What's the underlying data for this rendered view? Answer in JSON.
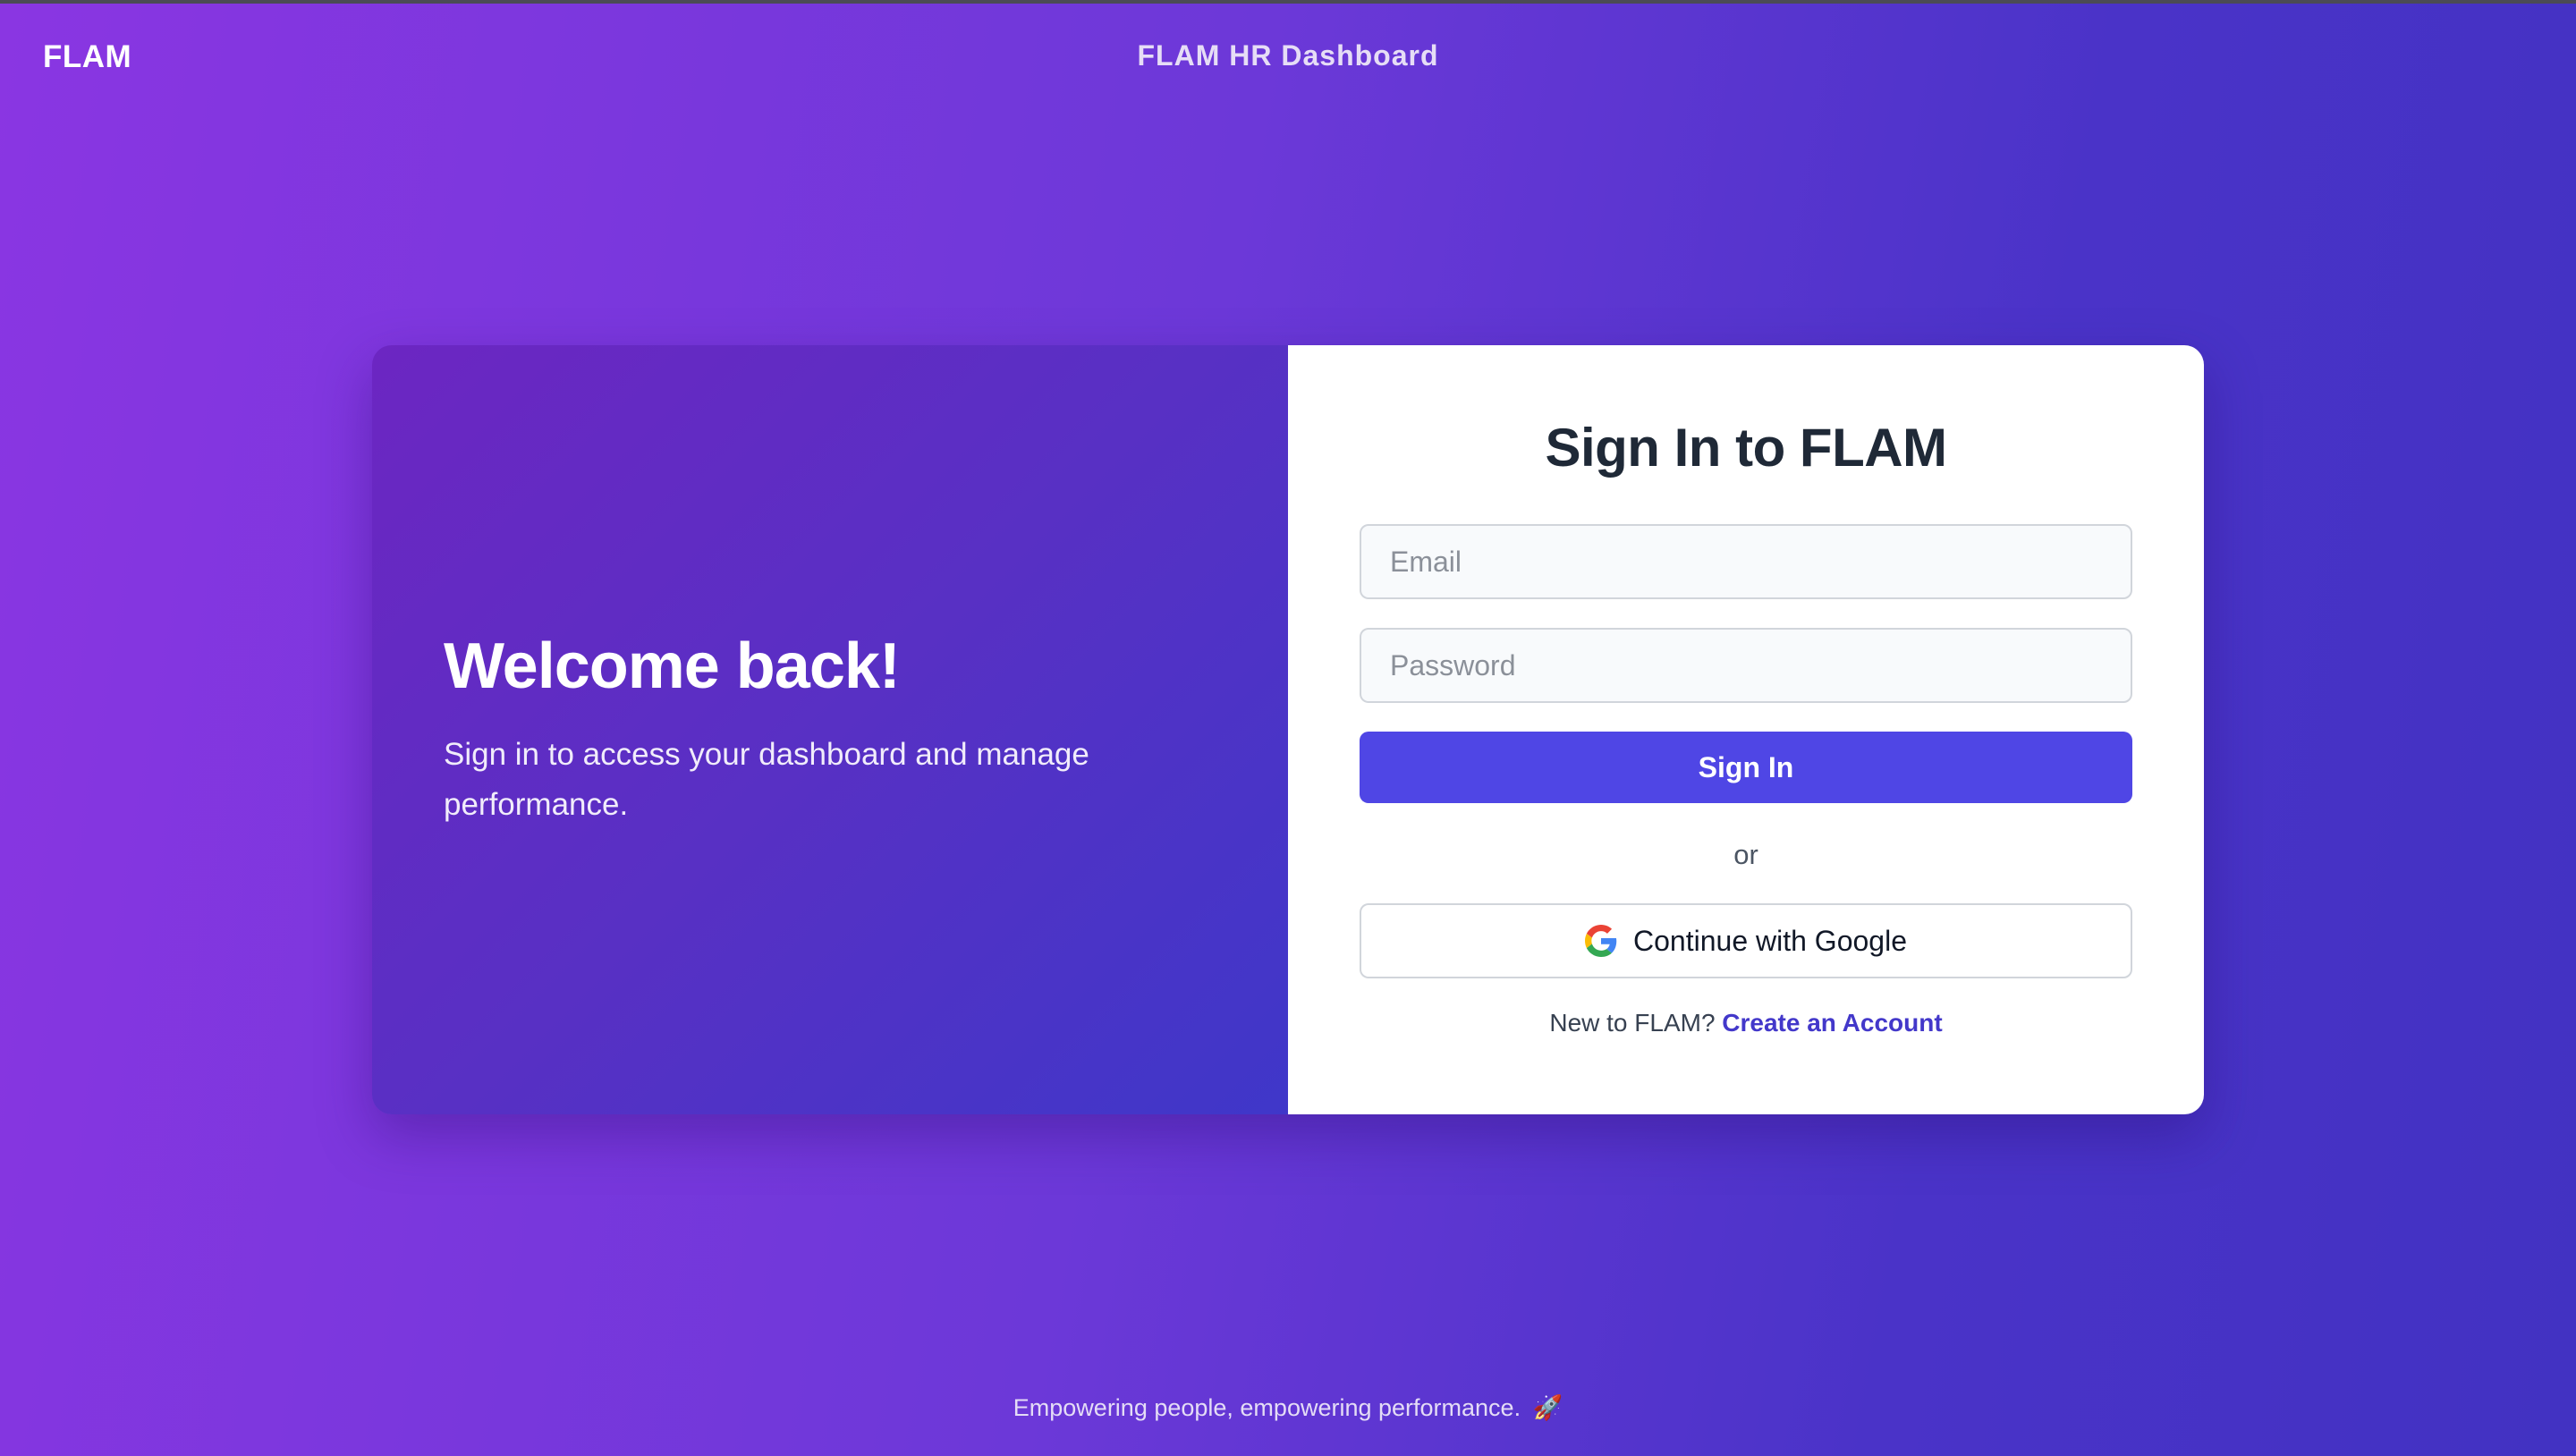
{
  "header": {
    "logo": "FLAM",
    "title": "FLAM HR Dashboard"
  },
  "welcome": {
    "title": "Welcome back!",
    "text": "Sign in to access your dashboard and manage performance."
  },
  "signin": {
    "title": "Sign In to FLAM",
    "email_placeholder": "Email",
    "email_value": "",
    "password_placeholder": "Password",
    "password_value": "",
    "submit_label": "Sign In",
    "divider": "or",
    "google_label": "Continue with Google",
    "google_icon": "google-g-icon",
    "signup_prompt": "New to FLAM?",
    "signup_link": "Create an Account"
  },
  "footer": {
    "text": "Empowering people, empowering performance.",
    "icon": "rocket-icon",
    "icon_glyph": "🚀"
  },
  "colors": {
    "primary": "#4f46e5",
    "link": "#4338ca",
    "gradient_start": "#8a36e2",
    "gradient_end": "#4232c2"
  }
}
